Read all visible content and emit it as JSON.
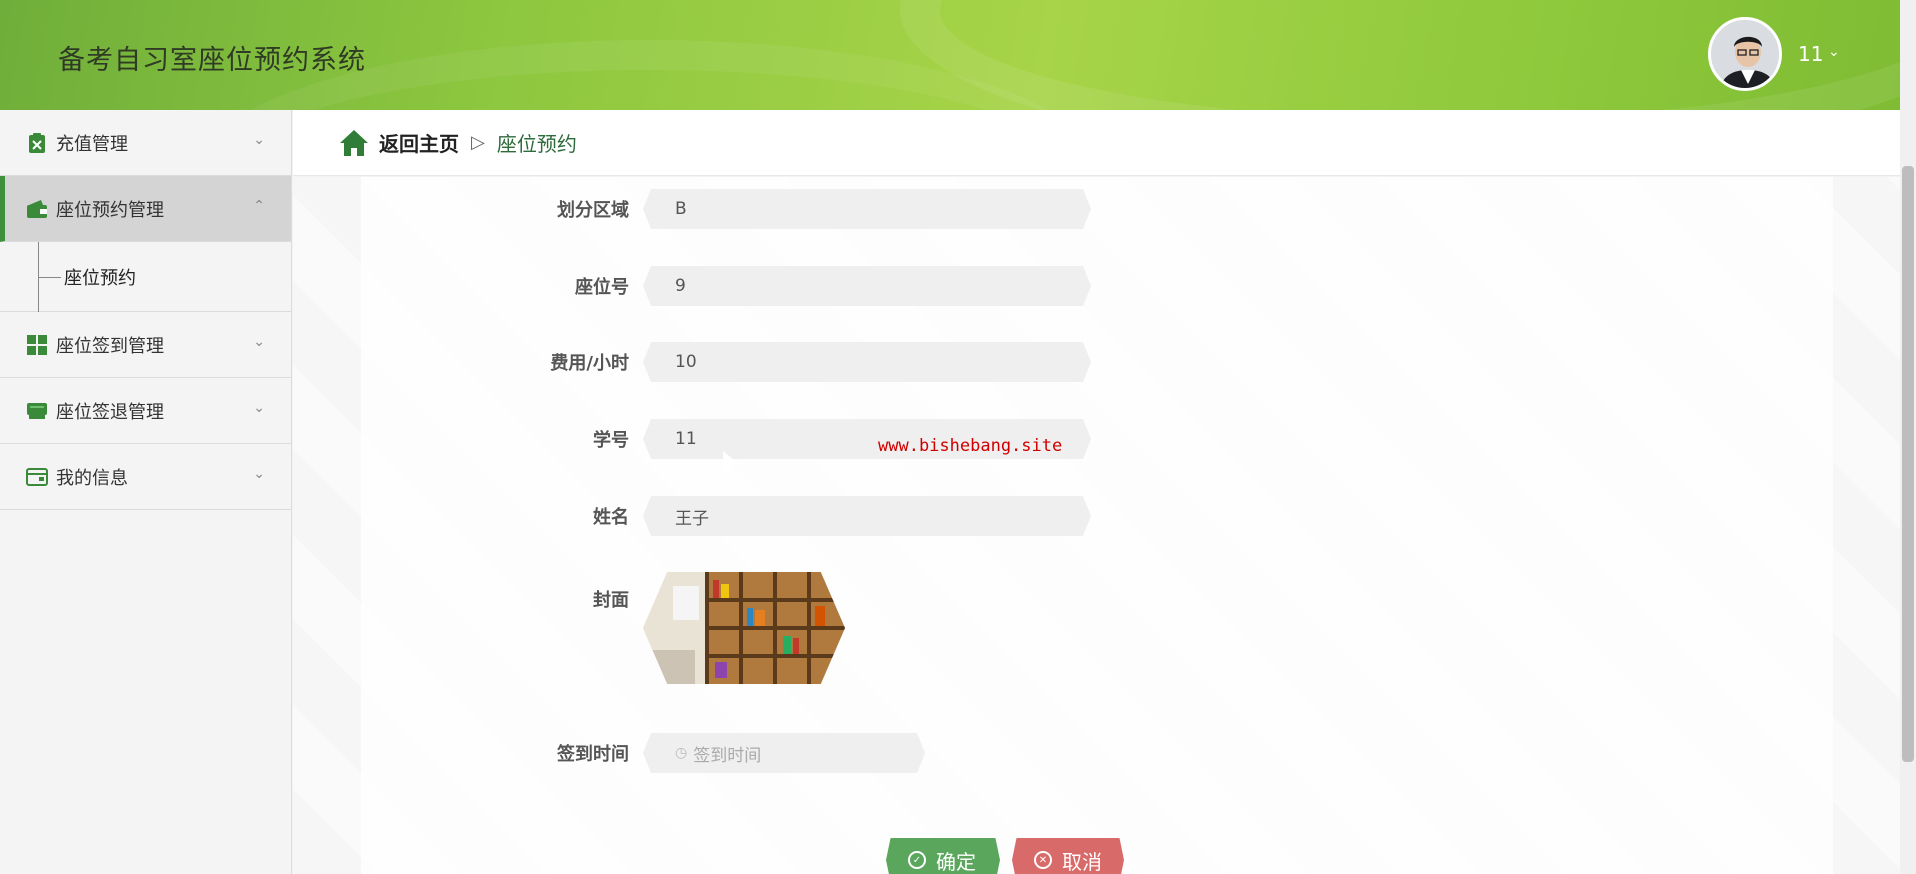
{
  "app": {
    "title": "备考自习室座位预约系统"
  },
  "user": {
    "name": "11",
    "caret": "⌄"
  },
  "sidebar": {
    "items": [
      {
        "label": "充值管理",
        "icon": "clipboard-icon",
        "caret": "⌄"
      },
      {
        "label": "座位预约管理",
        "icon": "wallet-icon",
        "caret": "⌃",
        "active": true
      },
      {
        "label": "座位签到管理",
        "icon": "grid-icon",
        "caret": "⌄"
      },
      {
        "label": "座位签退管理",
        "icon": "monitor-icon",
        "caret": "⌄"
      },
      {
        "label": "我的信息",
        "icon": "card-icon",
        "caret": "⌄"
      }
    ],
    "sub_item": "座位预约"
  },
  "breadcrumb": {
    "home": "返回主页",
    "separator": "▷",
    "current": "座位预约"
  },
  "form": {
    "area_label": "划分区域",
    "area_value": "B",
    "seat_label": "座位号",
    "seat_value": "9",
    "fee_label": "费用/小时",
    "fee_value": "10",
    "student_id_label": "学号",
    "student_id_value": "11",
    "name_label": "姓名",
    "name_value": "王子",
    "cover_label": "封面",
    "checkin_label": "签到时间",
    "checkin_placeholder": "签到时间"
  },
  "watermark": "www.bishebang.site",
  "buttons": {
    "ok": "确定",
    "cancel": "取消"
  },
  "colors": {
    "header": "#8cc63f",
    "ok": "#5aa65c",
    "cancel": "#d96a6a",
    "breadcrumb_current": "#2e6b3a",
    "active_menu_bar": "#3f8f3f"
  }
}
